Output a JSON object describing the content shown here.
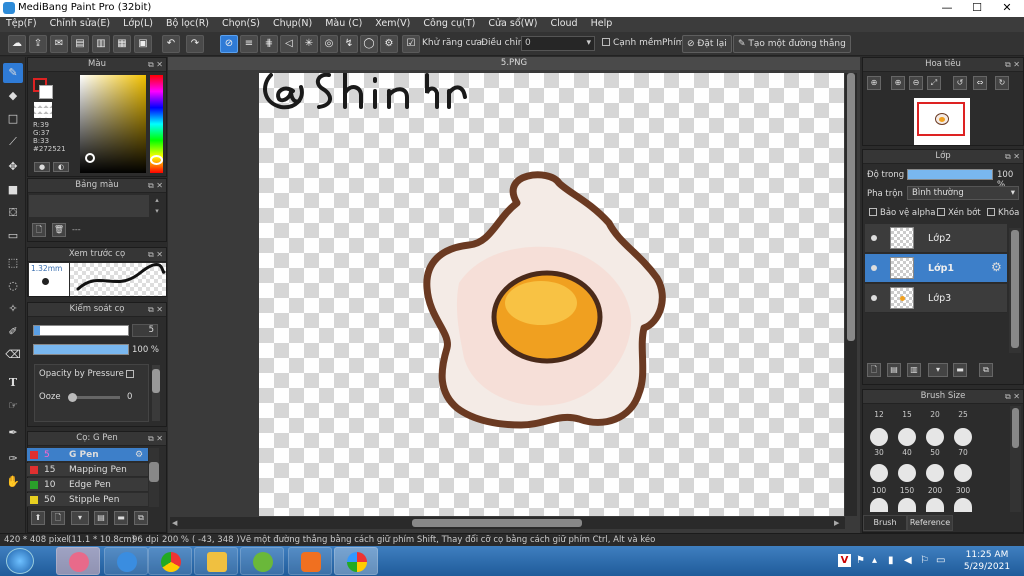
{
  "titlebar": {
    "title": "MediBang Paint Pro (32bit)",
    "minimize": "—",
    "maximize": "☐",
    "close": "✕"
  },
  "menu": [
    "Tệp(F)",
    "Chỉnh sửa(E)",
    "Lớp(L)",
    "Bộ lọc(R)",
    "Chọn(S)",
    "Chụp(N)",
    "Màu (C)",
    "Xem(V)",
    "Công cụ(T)",
    "Cửa sổ(W)",
    "Cloud",
    "Help"
  ],
  "toolbar": {
    "antialias_label": "Khử răng cưa",
    "correction_label": "Điều chỉnh",
    "correction_value": "0",
    "snap_label": "Cạnh mềm",
    "key_label": "Phím",
    "reset_label": "Đặt lại",
    "line_label": "Tạo một đường thẳng"
  },
  "color_panel": {
    "title": "Màu",
    "r": "R:39",
    "g": "G:37",
    "b": "B:33",
    "hex": "#272521",
    "fg_color": "#272521"
  },
  "palette_panel": {
    "title": "Bảng màu",
    "dash": "---"
  },
  "brush_preview": {
    "title": "Xem trước cọ",
    "size": "1.32mm"
  },
  "brush_control": {
    "title": "Kiểm soát cọ",
    "size_value": "5",
    "opacity_value": "100 %",
    "opacity_by_pressure": "Opacity by Pressure",
    "ooze_label": "Ooze",
    "ooze_value": "0"
  },
  "brush_list": {
    "title": "Cọ: G Pen",
    "items": [
      {
        "size": "5",
        "name": "G Pen",
        "color": "#e03030"
      },
      {
        "size": "15",
        "name": "Mapping Pen",
        "color": "#e03030"
      },
      {
        "size": "10",
        "name": "Edge Pen",
        "color": "#2aa02a"
      },
      {
        "size": "50",
        "name": "Stipple Pen",
        "color": "#e8d020"
      }
    ]
  },
  "document": {
    "tab": "5.PNG",
    "handwriting": "@shin"
  },
  "navigator": {
    "title": "Hoa tiêu"
  },
  "layer_panel": {
    "title": "Lớp",
    "opacity_label": "Độ trong",
    "opacity_value": "100 %",
    "blend_label": "Pha trộn",
    "blend_value": "Bình thường",
    "protect_alpha": "Bảo vệ alpha",
    "clipping": "Xén bớt",
    "lock": "Khóa",
    "layers": [
      "Lớp2",
      "Lớp1",
      "Lớp3"
    ]
  },
  "brush_size_panel": {
    "title": "Brush Size",
    "sizes": [
      "12",
      "15",
      "20",
      "25",
      "30",
      "40",
      "50",
      "70",
      "100",
      "150",
      "200",
      "300"
    ],
    "tab1": "Brush Size",
    "tab2": "Reference"
  },
  "status": {
    "dimensions": "420 * 408 pixel",
    "physical": "(11.1 * 10.8cm)",
    "dpi": "96 dpi",
    "zoom": "200 %",
    "coords": "( -43, 348 )",
    "hint": "Vẽ một đường thẳng bằng cách giữ phím Shift, Thay đổi cỡ cọ bằng cách giữ phím Ctrl, Alt và kéo"
  },
  "taskbar": {
    "time": "11:25 AM",
    "date": "5/29/2021"
  }
}
